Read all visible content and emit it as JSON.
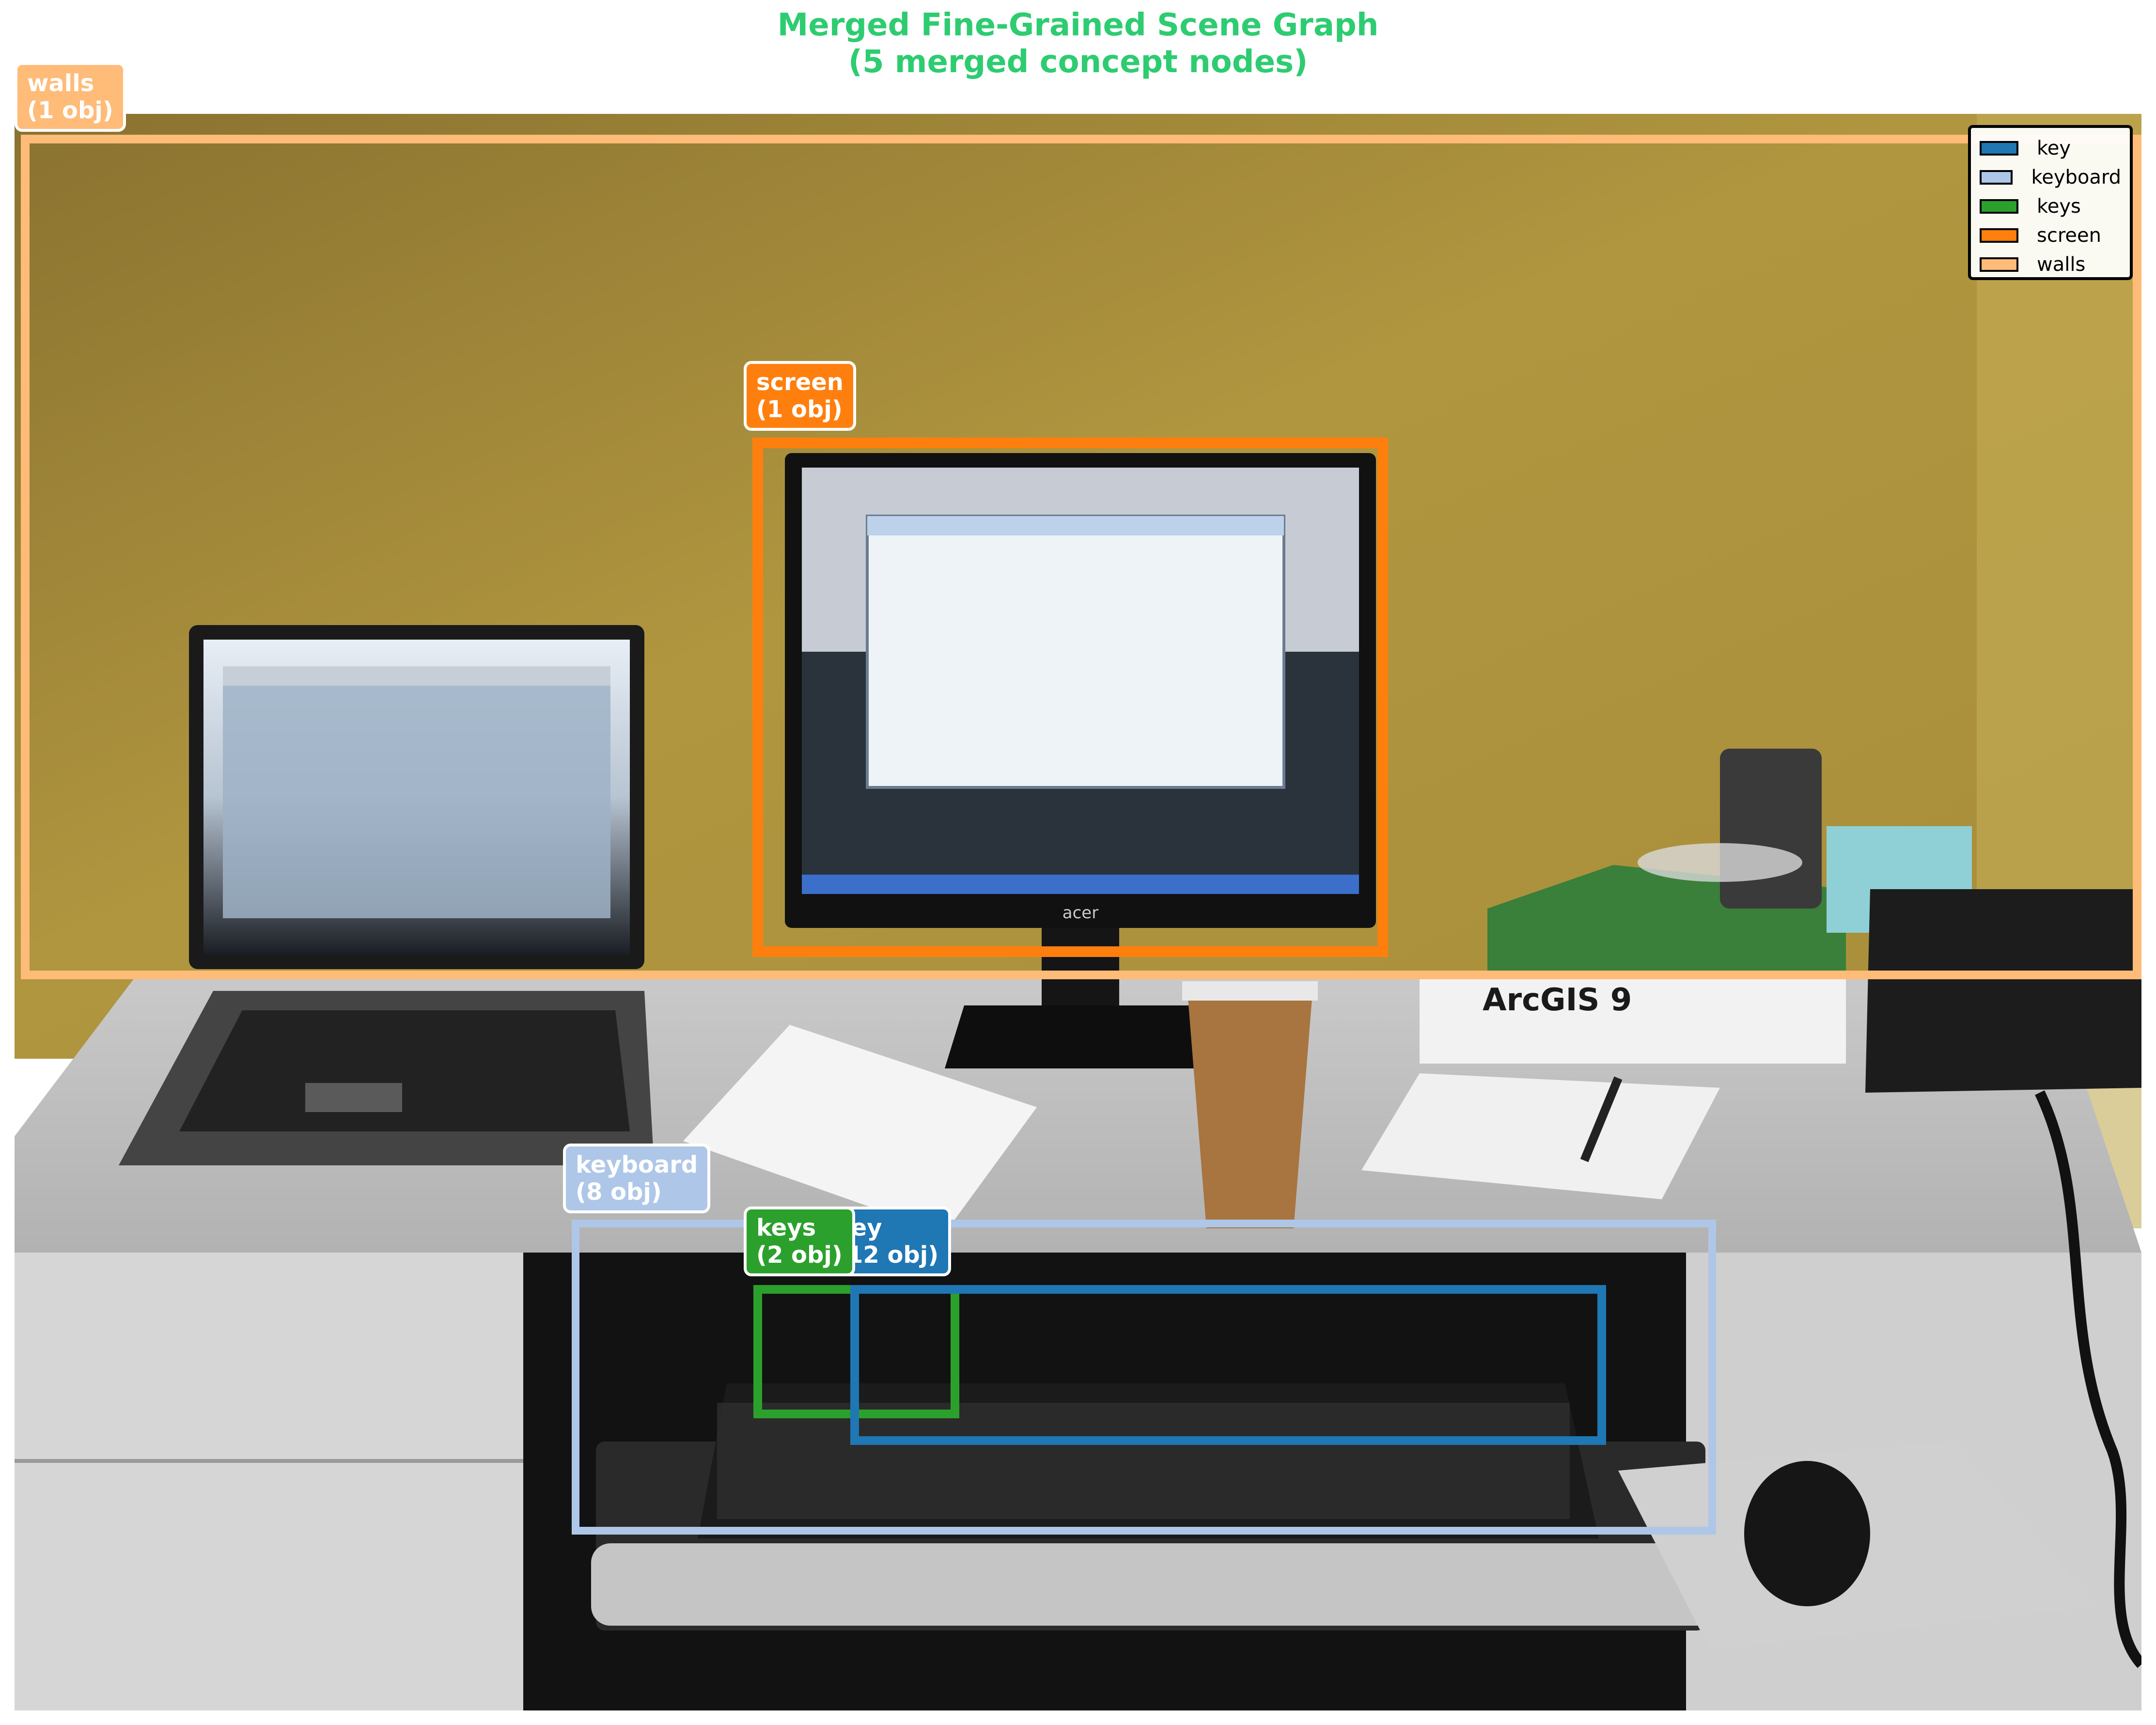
{
  "title": {
    "line1": "Merged Fine-Grained Scene Graph",
    "line2": "(5 merged concept nodes)"
  },
  "colors": {
    "title": "#2ecc71",
    "key": "#1f77b4",
    "keyboard": "#aec7e8",
    "keys": "#2ca02c",
    "screen": "#ff7f0e",
    "walls": "#ffbb78"
  },
  "regions": [
    {
      "name": "walls",
      "count": "(1 obj)"
    },
    {
      "name": "screen",
      "count": "(1 obj)"
    },
    {
      "name": "keyboard",
      "count": "(8 obj)"
    },
    {
      "name": "keys",
      "count": "(2 obj)"
    },
    {
      "name": "key",
      "count": "(12 obj)"
    }
  ],
  "legend": [
    "key",
    "keyboard",
    "keys",
    "screen",
    "walls"
  ],
  "photo_text": {
    "monitor_brand": "acer",
    "book_title": "ArcGIS 9"
  }
}
